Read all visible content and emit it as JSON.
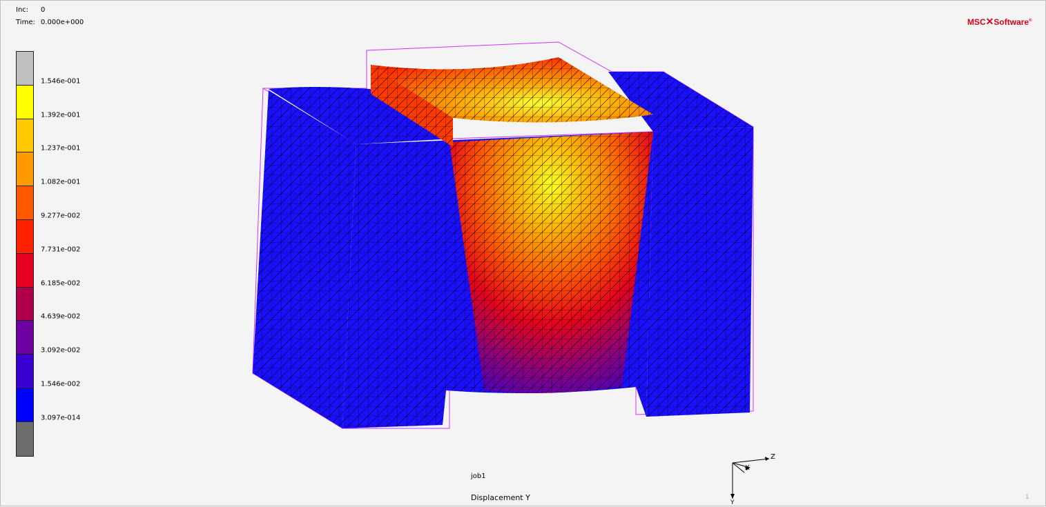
{
  "info": {
    "inc_label": "Inc:",
    "inc_value": "0",
    "time_label": "Time:",
    "time_value": "0.000e+000"
  },
  "brand": {
    "msc": "MSC",
    "software": "Software",
    "tm": "®"
  },
  "legend": {
    "bands": [
      "#c0c0c0",
      "#ffff00",
      "#ffc800",
      "#ff9a00",
      "#ff5a00",
      "#ff2200",
      "#e4001e",
      "#b0004c",
      "#6e00a0",
      "#3a00d0",
      "#0000ff",
      "#6c6c6c"
    ],
    "ticks": [
      "1.546e-001",
      "1.392e-001",
      "1.237e-001",
      "1.082e-001",
      "9.277e-002",
      "7.731e-002",
      "6.185e-002",
      "4.639e-002",
      "3.092e-002",
      "1.546e-002",
      "3.097e-014"
    ]
  },
  "job_name": "job1",
  "plot_variable": "Displacement Y",
  "axes": {
    "z": "Z",
    "x": "X",
    "y": "Y"
  },
  "corner_label": "1",
  "colors": {
    "mesh_line": "#000000",
    "bounding_box": "#cc33ff",
    "low": "#0000ff",
    "high": "#ffff00"
  }
}
